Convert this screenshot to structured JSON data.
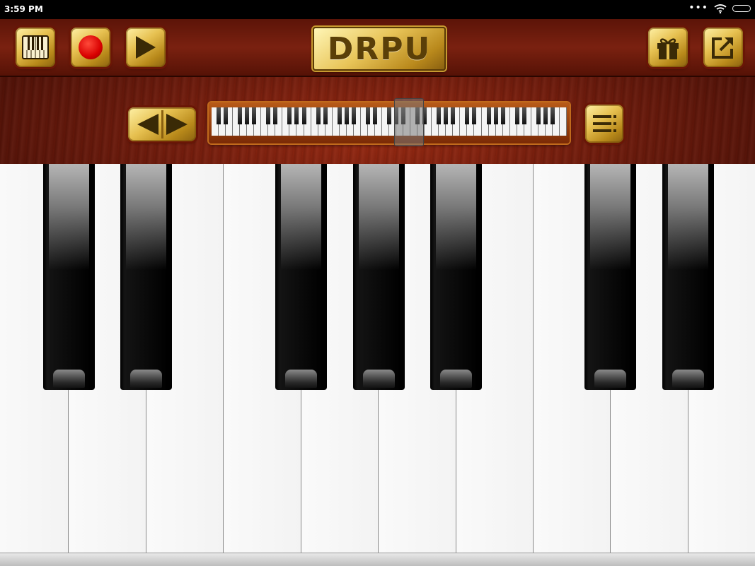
{
  "status_bar": {
    "time": "3:59 PM",
    "icons": [
      "more-dots-icon",
      "wifi-icon",
      "battery-icon"
    ]
  },
  "toolbar": {
    "logo_text": "DRPU",
    "left_buttons": [
      "keyboard-select-icon",
      "record-icon",
      "play-icon"
    ],
    "right_buttons": [
      "gift-icon",
      "share-export-icon"
    ]
  },
  "navigator": {
    "arrows": [
      "arrow-left-icon",
      "arrow-right-icon"
    ],
    "menu": "menu-list-icon",
    "mini_keyboard_white_keys": 50,
    "selected_range_start_key": 26
  },
  "keyboard": {
    "white_keys": 10,
    "black_keys": 7
  },
  "colors": {
    "gold": "#e6c050",
    "wood": "#6e1b0c",
    "record": "#d80000"
  }
}
